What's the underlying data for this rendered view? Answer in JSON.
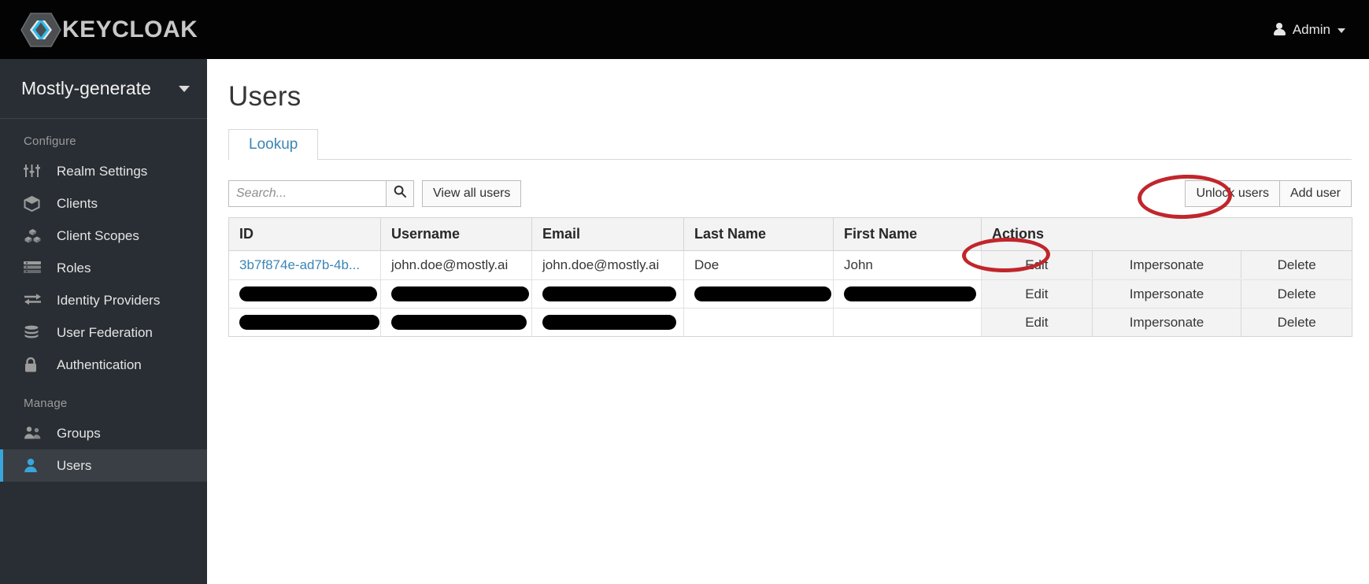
{
  "header": {
    "brand_text": "KEYCLOAK",
    "brand_icon": "keycloak-hexagon-logo",
    "user_menu_label": "Admin",
    "user_icon": "user-avatar-icon",
    "caret_icon": "chevron-down-icon"
  },
  "sidebar": {
    "realm": {
      "name": "Mostly-generate",
      "caret_icon": "chevron-down-icon"
    },
    "sections": [
      {
        "label": "Configure",
        "items": [
          {
            "label": "Realm Settings",
            "icon": "sliders-icon",
            "active": false
          },
          {
            "label": "Clients",
            "icon": "cube-icon",
            "active": false
          },
          {
            "label": "Client Scopes",
            "icon": "cubes-icon",
            "active": false
          },
          {
            "label": "Roles",
            "icon": "list-rows-icon",
            "active": false
          },
          {
            "label": "Identity Providers",
            "icon": "exchange-arrows-icon",
            "active": false
          },
          {
            "label": "User Federation",
            "icon": "database-icon",
            "active": false
          },
          {
            "label": "Authentication",
            "icon": "lock-icon",
            "active": false
          }
        ]
      },
      {
        "label": "Manage",
        "items": [
          {
            "label": "Groups",
            "icon": "users-group-icon",
            "active": false
          },
          {
            "label": "Users",
            "icon": "user-icon",
            "active": true
          }
        ]
      }
    ],
    "active_accent_color": "#39a5dc"
  },
  "main": {
    "page_title": "Users",
    "tabs": [
      {
        "label": "Lookup",
        "active": true
      }
    ],
    "toolbar": {
      "search_placeholder": "Search...",
      "search_value": "",
      "search_icon": "search-icon",
      "view_all_users_label": "View all users",
      "unlock_users_label": "Unlock users",
      "add_user_label": "Add user"
    },
    "table": {
      "columns": [
        "ID",
        "Username",
        "Email",
        "Last Name",
        "First Name",
        "Actions"
      ],
      "action_labels": [
        "Edit",
        "Impersonate",
        "Delete"
      ],
      "rows": [
        {
          "id": "3b7f874e-ad7b-4b...",
          "id_is_link": true,
          "username": "john.doe@mostly.ai",
          "email": "john.doe@mostly.ai",
          "last_name": "Doe",
          "first_name": "John",
          "redacted": {
            "id": false,
            "username": false,
            "email": false,
            "last_name": false,
            "first_name": false
          }
        },
        {
          "id": "",
          "id_is_link": false,
          "username": "",
          "email": "",
          "last_name": "",
          "first_name": "",
          "redacted": {
            "id": true,
            "username": true,
            "email": true,
            "last_name": true,
            "first_name": true
          }
        },
        {
          "id": "",
          "id_is_link": false,
          "username": "",
          "email": "",
          "last_name": "",
          "first_name": "",
          "redacted": {
            "id": true,
            "username": true,
            "email": true,
            "last_name": false,
            "first_name": false
          }
        }
      ]
    }
  },
  "annotations": {
    "color": "#c0262c",
    "shapes": [
      {
        "name": "add-user-highlight",
        "target": "Add user"
      },
      {
        "name": "edit-highlight",
        "target": "Edit"
      }
    ]
  }
}
